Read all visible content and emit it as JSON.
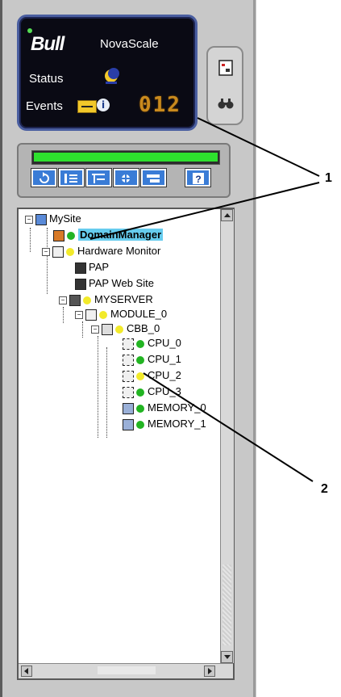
{
  "status_display": {
    "brand": "Bull",
    "product": "NovaScale",
    "status_label": "Status",
    "events_label": "Events",
    "event_count": "012",
    "info_symbol": "i"
  },
  "toolbar": {
    "progress": 1.0,
    "buttons": [
      {
        "icon": "refresh-icon"
      },
      {
        "icon": "expand-tree-icon"
      },
      {
        "icon": "collapse-tree-icon"
      },
      {
        "icon": "network-icon"
      },
      {
        "icon": "layout-icon"
      },
      {
        "icon": "help-icon",
        "label": "?"
      }
    ]
  },
  "side_tools": [
    {
      "icon": "view-icon"
    },
    {
      "icon": "find-icon"
    }
  ],
  "tree": {
    "nodes": [
      {
        "label": "MySite",
        "status": "none"
      },
      {
        "label": "DomainManager",
        "status": "green",
        "selected": true
      },
      {
        "label": "Hardware Monitor",
        "status": "yellow"
      },
      {
        "label": "PAP",
        "status": "none"
      },
      {
        "label": "PAP Web Site",
        "status": "none"
      },
      {
        "label": "MYSERVER",
        "status": "yellow"
      },
      {
        "label": "MODULE_0",
        "status": "yellow"
      },
      {
        "label": "CBB_0",
        "status": "yellow"
      },
      {
        "label": "CPU_0",
        "status": "green"
      },
      {
        "label": "CPU_1",
        "status": "green"
      },
      {
        "label": "CPU_2",
        "status": "yellow"
      },
      {
        "label": "CPU_3",
        "status": "green"
      },
      {
        "label": "MEMORY_0",
        "status": "green"
      },
      {
        "label": "MEMORY_1",
        "status": "green"
      }
    ]
  },
  "callouts": [
    "1",
    "2"
  ],
  "colors": {
    "progress": "#2ee02e",
    "status_ok": "#22b422",
    "status_warning": "#f2ea2a",
    "selection": "#66ccee",
    "toolbar_button": "#3a7cd6",
    "event_counter": "#c98a1e"
  }
}
